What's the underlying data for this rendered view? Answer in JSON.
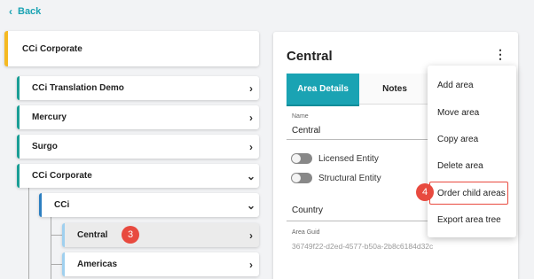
{
  "back": {
    "label": "Back"
  },
  "tree": {
    "root": {
      "label": "CCi Corporate"
    },
    "items": [
      {
        "label": "CCi Translation Demo",
        "expanded": false
      },
      {
        "label": "Mercury",
        "expanded": false
      },
      {
        "label": "Surgo",
        "expanded": false
      },
      {
        "label": "CCi Corporate",
        "expanded": true
      },
      {
        "label": "CCi",
        "expanded": true
      },
      {
        "label": "Central",
        "expanded": false,
        "selected": true
      },
      {
        "label": "Americas",
        "expanded": false
      }
    ]
  },
  "callouts": {
    "step3": "3",
    "step4": "4"
  },
  "panel": {
    "title": "Central",
    "tabs": [
      {
        "label": "Area Details",
        "active": true
      },
      {
        "label": "Notes",
        "active": false
      }
    ],
    "name_label": "Name",
    "name_value": "Central",
    "toggles": [
      {
        "label": "Licensed Entity",
        "on": false
      },
      {
        "label": "Structural Entity",
        "on": false
      }
    ],
    "country_label": "Country",
    "guid_label": "Area Guid",
    "guid_value": "36749f22-d2ed-4577-b50a-2b8c6184d32c"
  },
  "menu": {
    "items": [
      "Add area",
      "Move area",
      "Copy area",
      "Delete area",
      "Order child areas",
      "Export area tree"
    ]
  },
  "colors": {
    "accent": "#1aa3b3",
    "root_border": "#f5b921",
    "level1_border": "#1a9e95",
    "level2_border": "#2d7fc1",
    "level3_border": "#9fd0ef",
    "callout": "#e84a3f"
  }
}
